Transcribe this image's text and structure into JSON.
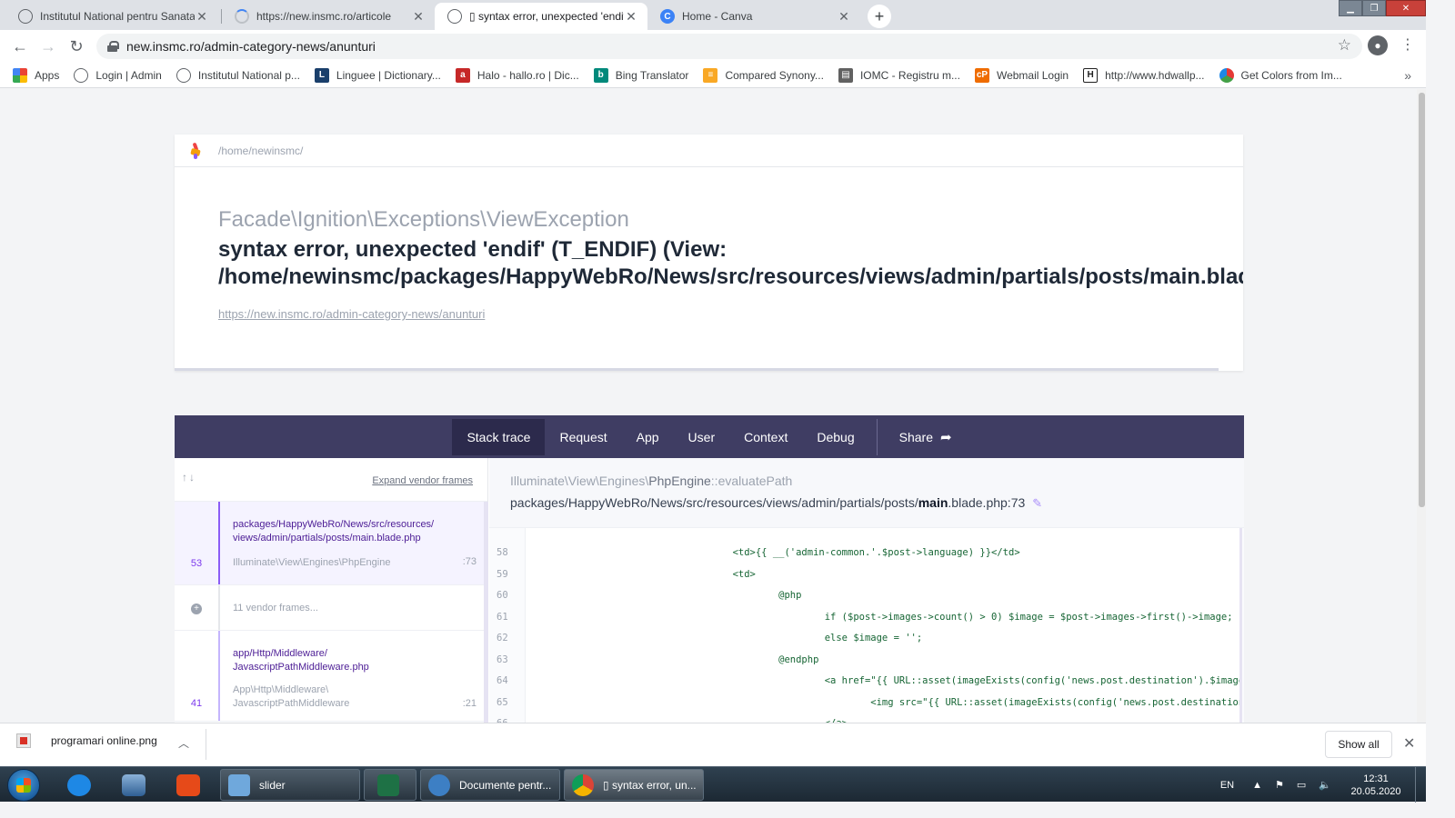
{
  "browser": {
    "tabs": [
      {
        "title": "Institutul National pentru Sanatate",
        "favicon": "globe-icon",
        "active": false
      },
      {
        "title": "https://new.insmc.ro/articole",
        "favicon": "loading-icon",
        "active": false
      },
      {
        "title": "▯ syntax error, unexpected 'endif'",
        "favicon": "globe-icon",
        "active": true
      },
      {
        "title": "Home - Canva",
        "favicon": "canva-icon",
        "active": false
      }
    ],
    "url": "new.insmc.ro/admin-category-news/anunturi",
    "bookmarks": [
      {
        "label": "Apps",
        "icon": "apps-grid-icon",
        "color": "#4285f4"
      },
      {
        "label": "Login | Admin",
        "icon": "globe-icon",
        "color": "#5f6368"
      },
      {
        "label": "Institutul National p...",
        "icon": "globe-icon",
        "color": "#5f6368"
      },
      {
        "label": "Linguee | Dictionary...",
        "icon": "linguee-icon",
        "color": "#1a3f6b"
      },
      {
        "label": "Halo - hallo.ro | Dic...",
        "icon": "halo-icon",
        "color": "#c62828"
      },
      {
        "label": "Bing Translator",
        "icon": "bing-icon",
        "color": "#00897b"
      },
      {
        "label": "Compared Synony...",
        "icon": "compared-icon",
        "color": "#f9a825"
      },
      {
        "label": "IOMC - Registru m...",
        "icon": "printer-icon",
        "color": "#616161"
      },
      {
        "label": "Webmail Login",
        "icon": "webmail-icon",
        "color": "#ef6c00"
      },
      {
        "label": "http://www.hdwallp...",
        "icon": "hd-icon",
        "color": "#212121"
      },
      {
        "label": "Get Colors from Im...",
        "icon": "colors-icon",
        "color": "#43a047"
      }
    ]
  },
  "page": {
    "root_path": "/home/newinsmc/",
    "exception_class": "Facade\\Ignition\\Exceptions\\ViewException",
    "message_line1": "syntax error, unexpected 'endif' (T_ENDIF) (View:",
    "message_line2": "/home/newinsmc/packages/HappyWebRo/News/src/resources/views/admin/partials/posts/main.blade.php)",
    "request_url": "https://new.insmc.ro/admin-category-news/anunturi",
    "nav_tabs": [
      "Stack trace",
      "Request",
      "App",
      "User",
      "Context",
      "Debug"
    ],
    "share_label": "Share",
    "expand_vendor": "Expand vendor frames",
    "frames": [
      {
        "number": "53",
        "file_line1": "packages/HappyWebRo/News/src/resources/",
        "file_line2": "views/admin/partials/posts/main.blade.php",
        "class": "Illuminate\\View\\Engines\\PhpEngine",
        "class2": "",
        "line": ":73",
        "selected": true
      },
      {
        "number": "41",
        "file_line1": "app/Http/Middleware/",
        "file_line2": "JavascriptPathMiddleware.php",
        "class": "App\\Http\\Middleware\\",
        "class2": "JavascriptPathMiddleware",
        "line": ":21",
        "selected": false
      }
    ],
    "vendor_frames": "11 vendor frames...",
    "code": {
      "class_prefix": "Illuminate\\View\\Engines\\",
      "class_name": "PhpEngine",
      "method": "::evaluatePath",
      "file_prefix": "packages/HappyWebRo/News/src/resources/views/admin/partials/posts/",
      "file_name": "main",
      "file_suffix": ".blade.php:73",
      "lines": [
        {
          "n": "58",
          "code": "                                    <td>{{ __('admin-common.'.$post->language) }}</td>"
        },
        {
          "n": "59",
          "code": "                                    <td>"
        },
        {
          "n": "60",
          "code": "                                            @php"
        },
        {
          "n": "61",
          "code": "                                                    if ($post->images->count() > 0) $image = $post->images->first()->image;"
        },
        {
          "n": "62",
          "code": "                                                    else $image = '';"
        },
        {
          "n": "63",
          "code": "                                            @endphp"
        },
        {
          "n": "64",
          "code": "                                                    <a href=\"{{ URL::asset(imageExists(config('news.post.destination').$image"
        },
        {
          "n": "65",
          "code": "                                                            <img src=\"{{ URL::asset(imageExists(config('news.post.destination"
        },
        {
          "n": "66",
          "code": "                                                    </a>"
        }
      ]
    }
  },
  "downloads": {
    "file": "programari online.png",
    "show_all": "Show all"
  },
  "taskbar": {
    "buttons": [
      {
        "label": "slider",
        "glyph_color": "#6fa8dc"
      },
      {
        "label": "",
        "glyph_color": "#1e7145"
      },
      {
        "label": "Documente pentr...",
        "glyph_color": "#3d7fc4"
      },
      {
        "label": "▯ syntax error, un...",
        "glyph_color": "#db4437"
      }
    ],
    "language": "EN",
    "time": "12:31",
    "date": "20.05.2020"
  }
}
